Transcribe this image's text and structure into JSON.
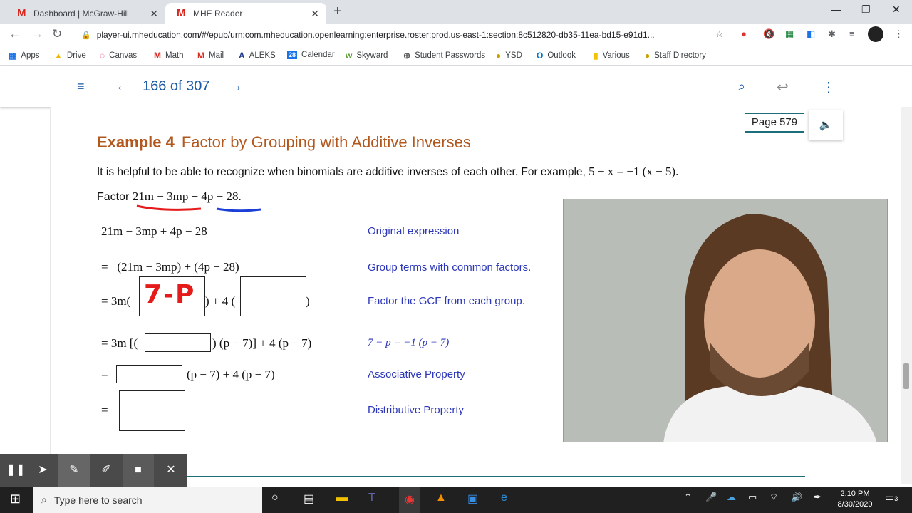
{
  "browser": {
    "tabs": [
      {
        "title": "Dashboard | McGraw-Hill",
        "favicon": "M"
      },
      {
        "title": "MHE Reader",
        "favicon": "M"
      }
    ],
    "new_tab_icon": "+",
    "url": "player-ui.mheducation.com/#/epub/urn:com.mheducation.openlearning:enterprise.roster:prod.us-east-1:section:8c512820-db35-11ea-bd15-e91d1...",
    "bookmarks": [
      "Apps",
      "Drive",
      "Canvas",
      "Math",
      "Mail",
      "ALEKS",
      "Calendar",
      "Skyward",
      "Student Passwords",
      "YSD",
      "Outlook",
      "Various",
      "Staff Directory"
    ]
  },
  "reader": {
    "page_count": "166 of 307",
    "page_label": "Page 579"
  },
  "lesson": {
    "example_label": "Example 4",
    "example_title": "Factor by Grouping with Additive Inverses",
    "intro": "It is helpful to be able to recognize when binomials are additive inverses of each other. For example,",
    "intro_math": "5 − x = −1 (x − 5).",
    "factor_label": "Factor",
    "factor_expr": "21m − 3mp + 4p − 28.",
    "steps": [
      {
        "expr": "21m − 3mp + 4p − 28",
        "note": "Original expression"
      },
      {
        "expr": "=   (21m − 3mp) + (4p − 28)",
        "note": "Group terms with common factors."
      },
      {
        "expr_left": "= 3m(",
        "handwritten": "7-P",
        "expr_mid": ") + 4 (",
        "expr_right": ")",
        "note": "Factor the GCF from each group."
      },
      {
        "expr_left": "= 3m [(",
        "expr_right": ") (p − 7)] + 4 (p − 7)",
        "note": "7 − p = −1 (p − 7)"
      },
      {
        "expr_left": "=",
        "expr_right": "(p − 7) + 4 (p − 7)",
        "note": "Associative Property"
      },
      {
        "expr_left": "=",
        "note": "Distributive Property"
      }
    ]
  },
  "annotation_toolbar": [
    "pause",
    "pointer",
    "pen",
    "highlighter",
    "camera",
    "close"
  ],
  "taskbar": {
    "search_placeholder": "Type here to search",
    "time": "2:10 PM",
    "date": "8/30/2020",
    "notification_count": "3"
  }
}
